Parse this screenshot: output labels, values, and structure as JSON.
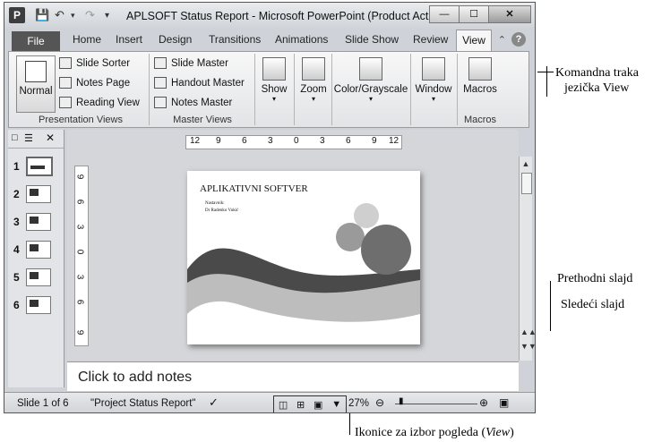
{
  "window": {
    "title": "APLSOFT Status Report - Microsoft PowerPoint (Product Act...",
    "app_icon": "P",
    "minimize": "—",
    "maximize": "☐",
    "close": "✕"
  },
  "tabs": {
    "file": "File",
    "items": [
      "Home",
      "Insert",
      "Design",
      "Transitions",
      "Animations",
      "Slide Show",
      "Review"
    ],
    "active": "View"
  },
  "ribbon": {
    "normal": "Normal",
    "slide_sorter": "Slide Sorter",
    "notes_page": "Notes Page",
    "reading_view": "Reading View",
    "presentation_views": "Presentation Views",
    "slide_master": "Slide Master",
    "handout_master": "Handout Master",
    "notes_master": "Notes Master",
    "master_views": "Master Views",
    "show": "Show",
    "zoom": "Zoom",
    "color_grayscale": "Color/Grayscale",
    "window": "Window",
    "macros": "Macros",
    "macros_group": "Macros"
  },
  "thumbnails": [
    "1",
    "2",
    "3",
    "4",
    "5",
    "6"
  ],
  "ruler": {
    "horizontal": [
      "12",
      "9",
      "6",
      "3",
      "0",
      "3",
      "6",
      "9",
      "12"
    ],
    "vertical": [
      "9",
      "6",
      "3",
      "0",
      "3",
      "6",
      "9"
    ]
  },
  "slide": {
    "title": "APLIKATIVNI SOFTVER",
    "line1": "Nastavnik:",
    "line2": "Dr Radenko Vukić"
  },
  "notes_placeholder": "Click to add notes",
  "status": {
    "slide": "Slide 1 of 6",
    "theme": "\"Project Status Report\"",
    "zoom": "27%"
  },
  "annotations": {
    "ribbon_line1": "Komandna traka",
    "ribbon_line2": "jezička View",
    "prev": "Prethodni slajd",
    "next": "Sledeći slajd",
    "views_prefix": "Ikonice za izbor pogleda (",
    "views_italic": "View",
    "views_suffix": ")"
  },
  "colors": {
    "file_tab": "#555555",
    "ribbon_bg": "#ececec"
  }
}
